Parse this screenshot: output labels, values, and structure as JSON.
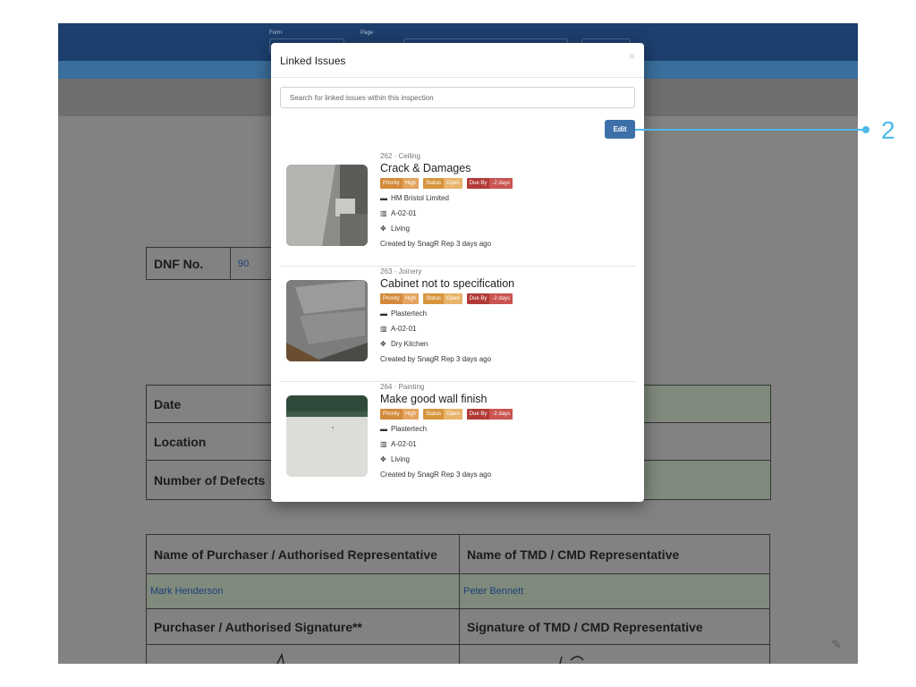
{
  "header": {
    "form_label": "Form",
    "page_label": "Page"
  },
  "document": {
    "dnf_label": "DNF No.",
    "dnf_value": "90",
    "rows": [
      {
        "label": "Date"
      },
      {
        "label": "Location"
      },
      {
        "label": "Number of Defects"
      }
    ],
    "purchaser_header": "Name of Purchaser / Authorised Representative",
    "tmd_header": "Name of TMD / CMD Representative",
    "purchaser_name": "Mark Henderson",
    "tmd_name": "Peter Bennett",
    "purchaser_sig_label": "Purchaser / Authorised Signature**",
    "tmd_sig_label": "Signature of TMD / CMD Representative"
  },
  "modal": {
    "title": "Linked Issues",
    "close": "×",
    "search_placeholder": "Search for linked issues within this inspection",
    "edit_label": "Edit",
    "issues": [
      {
        "category": "262 · Ceiling",
        "title": "Crack & Damages",
        "priority_label": "Priority",
        "priority_value": "High",
        "status_label": "Status",
        "status_value": "Open",
        "due_label": "Due By",
        "due_value": "-2 days",
        "company": "HM Bristol Limited",
        "drawing": "A-02-01",
        "location": "Living",
        "created": "Created by SnagR Rep 3 days ago"
      },
      {
        "category": "263 · Joinery",
        "title": "Cabinet not to specification",
        "priority_label": "Priority",
        "priority_value": "High",
        "status_label": "Status",
        "status_value": "Open",
        "due_label": "Due By",
        "due_value": "-2 days",
        "company": "Plastertech",
        "drawing": "A-02-01",
        "location": "Dry Kitchen",
        "created": "Created by SnagR Rep 3 days ago"
      },
      {
        "category": "264 · Painting",
        "title": "Make good wall finish",
        "priority_label": "Priority",
        "priority_value": "High",
        "status_label": "Status",
        "status_value": "Open",
        "due_label": "Due By",
        "due_value": "-2 days",
        "company": "Plastertech",
        "drawing": "A-02-01",
        "location": "Living",
        "created": "Created by SnagR Rep 3 days ago"
      }
    ]
  },
  "callout": {
    "number": "2"
  },
  "colors": {
    "accent": "#4db8e8",
    "edit_button": "#3d6fa8",
    "header": "#1d3f6e"
  }
}
